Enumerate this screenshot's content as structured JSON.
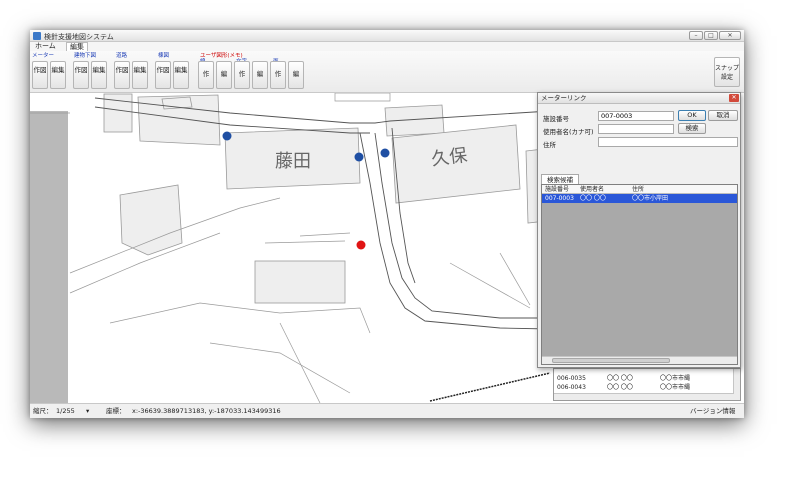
{
  "window": {
    "title": "検針支援地図システム",
    "min": "–",
    "max": "□",
    "close": "✕"
  },
  "menu": {
    "tabs": [
      {
        "label": "ホーム"
      },
      {
        "label": "編集"
      }
    ]
  },
  "ribbon": {
    "groups": [
      {
        "label": "メーター",
        "buttons": [
          "作図",
          "編集"
        ]
      },
      {
        "label": "建物下図",
        "buttons": [
          "作図",
          "編集"
        ]
      },
      {
        "label": "道路",
        "buttons": [
          "作図",
          "編集"
        ]
      },
      {
        "label": "棟図",
        "buttons": [
          "作図",
          "編集"
        ]
      },
      {
        "label": "ユーザ図形(メモ)",
        "buttons": []
      },
      {
        "label": "線",
        "buttons": [
          "作",
          "編"
        ]
      },
      {
        "label": "文字",
        "buttons": [
          "作",
          "編"
        ]
      },
      {
        "label": "面",
        "buttons": [
          "作",
          "編"
        ]
      }
    ],
    "snap_label": "スナップ設定"
  },
  "map": {
    "labels": {
      "left": "藤田",
      "right": "久保"
    },
    "colors": {
      "point": "#1f4fa3",
      "selected_point": "#e01414"
    }
  },
  "status": {
    "scale_label": "縮尺：",
    "scale_value": "1/255",
    "coord_label": "座標：",
    "coord_value": "x:-36639.3889713183, y:-187033.143499316",
    "version": "バージョン情報"
  },
  "dialog": {
    "title": "メーターリンク",
    "close": "✕",
    "facility_label": "施設番号",
    "facility_value": "007-0003",
    "user_label": "使用者名(カナ可)",
    "user_value": "",
    "address_label": "住所",
    "address_value": "",
    "ok": "OK",
    "cancel": "取消",
    "search": "検索",
    "tab": "検索候補",
    "columns": [
      "施設番号",
      "使用者名",
      "住所"
    ],
    "rows": [
      {
        "id": "007-0003",
        "name": "〇〇 〇〇",
        "address": "〇〇市小岸田"
      }
    ]
  },
  "bottom_list": {
    "rows": [
      {
        "id": "006-0035",
        "name": "〇〇 〇〇",
        "address": "〇〇市市縄"
      },
      {
        "id": "006-0043",
        "name": "〇〇 〇〇",
        "address": "〇〇市市縄"
      }
    ]
  }
}
